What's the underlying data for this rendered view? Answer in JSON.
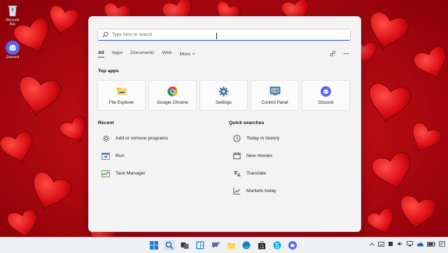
{
  "desktop": {
    "icons": [
      {
        "label": "Recycle Bin",
        "icon": "recycle-bin-icon"
      },
      {
        "label": "Discord",
        "icon": "discord-icon"
      }
    ]
  },
  "search": {
    "placeholder": "Type here to search"
  },
  "tabs": [
    {
      "label": "All",
      "active": true
    },
    {
      "label": "Apps"
    },
    {
      "label": "Documents"
    },
    {
      "label": "Web"
    },
    {
      "label": "More"
    }
  ],
  "top_apps": {
    "title": "Top apps",
    "items": [
      {
        "label": "File Explorer",
        "icon": "folder-icon"
      },
      {
        "label": "Google Chrome",
        "icon": "chrome-icon"
      },
      {
        "label": "Settings",
        "icon": "gear-icon"
      },
      {
        "label": "Control Panel",
        "icon": "control-panel-icon"
      },
      {
        "label": "Discord",
        "icon": "discord-icon"
      }
    ]
  },
  "recent": {
    "title": "Recent",
    "items": [
      {
        "label": "Add or remove programs",
        "icon": "gear-icon"
      },
      {
        "label": "Run",
        "icon": "run-icon"
      },
      {
        "label": "Task Manager",
        "icon": "task-manager-icon"
      }
    ]
  },
  "quick_searches": {
    "title": "Quick searches",
    "items": [
      {
        "label": "Today in history",
        "icon": "clock-icon"
      },
      {
        "label": "New movies",
        "icon": "movie-icon"
      },
      {
        "label": "Translate",
        "icon": "translate-icon"
      },
      {
        "label": "Markets today",
        "icon": "chart-icon"
      }
    ]
  },
  "taskbar": {
    "apps": [
      "windows-start-icon",
      "search-icon",
      "task-view-icon",
      "widgets-icon",
      "chat-icon",
      "file-explorer-icon",
      "edge-icon",
      "store-icon",
      "skype-icon",
      "discord-icon"
    ]
  },
  "colors": {
    "accent": "#1a5fb4",
    "wallpaper": "#c4101a",
    "discord": "#5865f2"
  }
}
